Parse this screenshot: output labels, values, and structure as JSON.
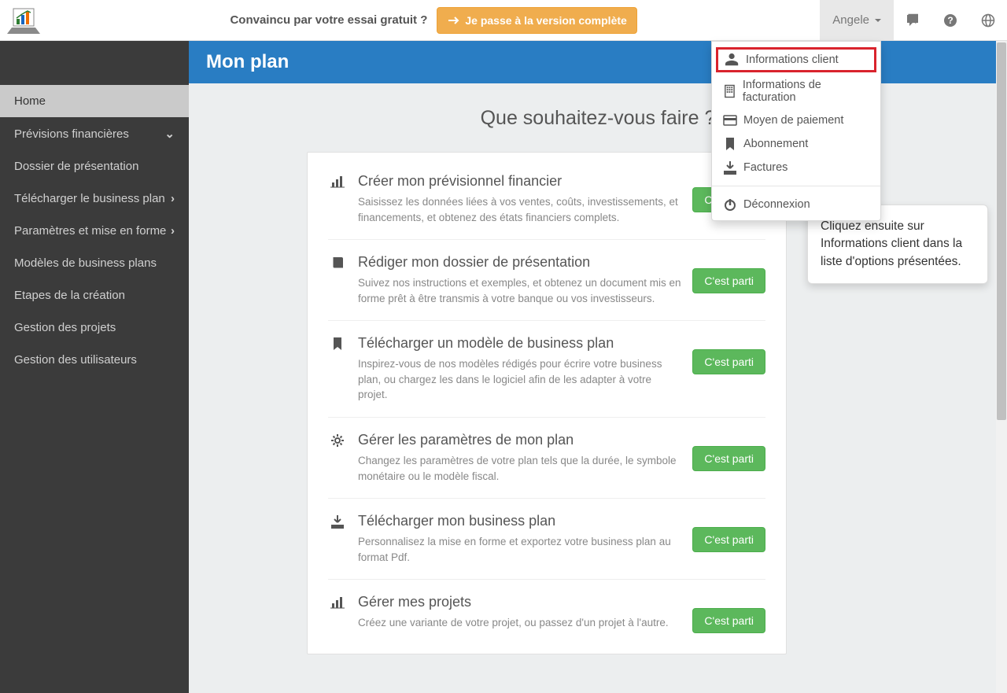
{
  "topbar": {
    "trial_text": "Convaincu par votre essai gratuit ?",
    "upgrade_label": "Je passe à la version complète",
    "user_name": "Angele"
  },
  "dropdown": {
    "items": [
      {
        "label": "Informations client",
        "icon": "user-icon",
        "highlight": true
      },
      {
        "label": "Informations de facturation",
        "icon": "building-icon"
      },
      {
        "label": "Moyen de paiement",
        "icon": "credit-card-icon"
      },
      {
        "label": "Abonnement",
        "icon": "bookmark-icon"
      },
      {
        "label": "Factures",
        "icon": "download-icon"
      }
    ],
    "logout_label": "Déconnexion"
  },
  "sidebar": {
    "items": [
      {
        "label": "Home",
        "active": true
      },
      {
        "label": "Prévisions financières",
        "has_children": true,
        "chev": "down"
      },
      {
        "label": "Dossier de présentation"
      },
      {
        "label": "Télécharger le business plan",
        "has_children": true,
        "chev": "right"
      },
      {
        "label": "Paramètres et mise en forme",
        "has_children": true,
        "chev": "right"
      },
      {
        "label": "Modèles de business plans"
      },
      {
        "label": "Etapes de la création"
      },
      {
        "label": "Gestion des projets"
      },
      {
        "label": "Gestion des utilisateurs"
      }
    ]
  },
  "bluebar": {
    "title": "Mon plan"
  },
  "main": {
    "question": "Que souhaitez-vous faire ?",
    "go_label": "C'est parti",
    "tasks": [
      {
        "title": "Créer mon prévisionnel financier",
        "desc": "Saisissez les données liées à vos ventes, coûts, investissements, et financements, et obtenez des états financiers complets.",
        "icon": "bar-chart-icon"
      },
      {
        "title": "Rédiger mon dossier de présentation",
        "desc": "Suivez nos instructions et exemples, et obtenez un document mis en forme prêt à être transmis à votre banque ou vos investisseurs.",
        "icon": "book-icon"
      },
      {
        "title": "Télécharger un modèle de business plan",
        "desc": "Inspirez-vous de nos modèles rédigés pour écrire votre business plan, ou chargez les dans le logiciel afin de les adapter à votre projet.",
        "icon": "bookmark-icon"
      },
      {
        "title": "Gérer les paramètres de mon plan",
        "desc": "Changez les paramètres de votre plan tels que la durée, le symbole monétaire ou le modèle fiscal.",
        "icon": "gear-icon"
      },
      {
        "title": "Télécharger mon business plan",
        "desc": "Personnalisez la mise en forme et exportez votre business plan au format Pdf.",
        "icon": "download-icon"
      },
      {
        "title": "Gérer mes projets",
        "desc": "Créez une variante de votre projet, ou passez d'un projet à l'autre.",
        "icon": "bar-chart-icon"
      }
    ]
  },
  "callout": {
    "text": "Cliquez ensuite sur Informations client dans la liste d'options présentées."
  }
}
